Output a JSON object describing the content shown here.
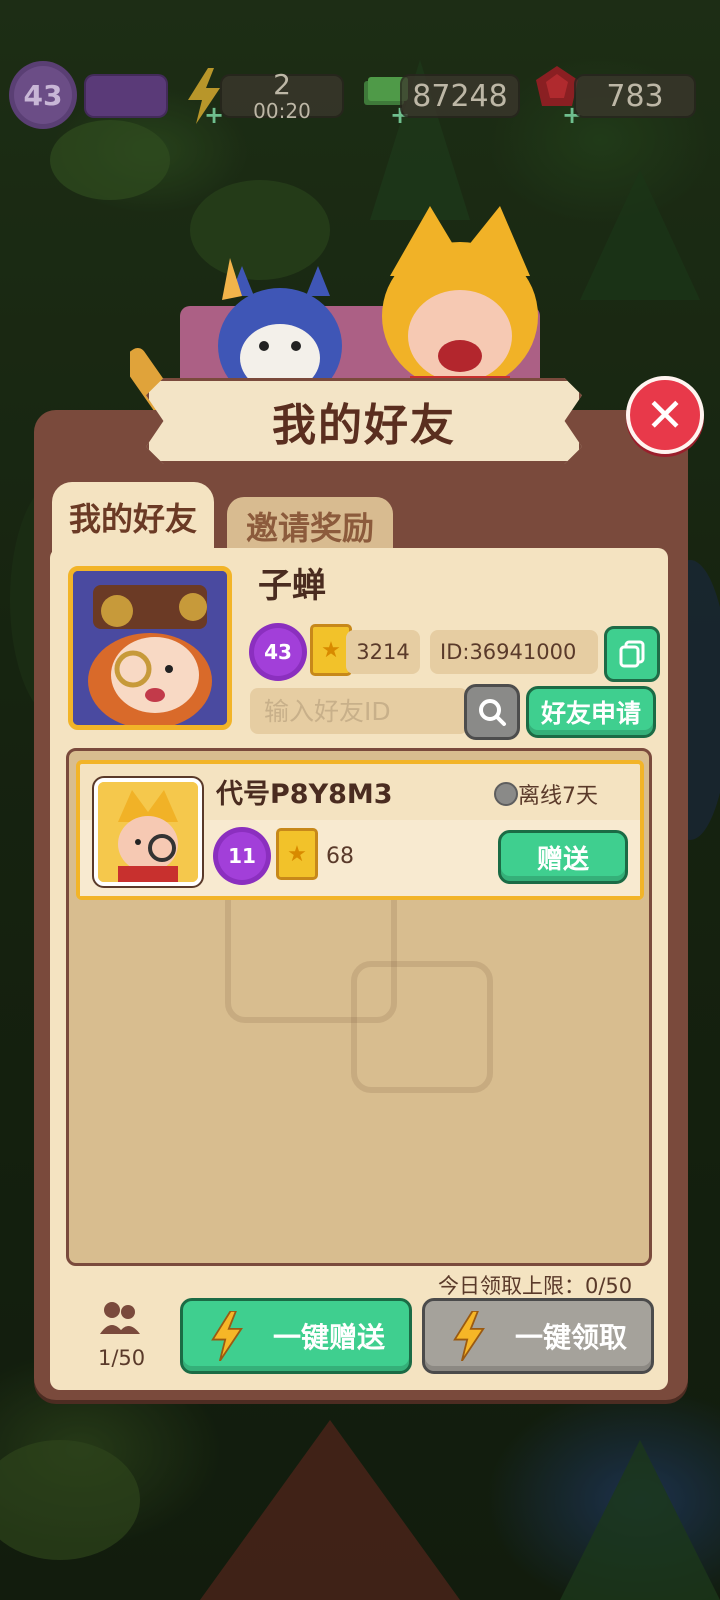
{
  "hud": {
    "level": "43",
    "energy_value": "2",
    "energy_timer": "00:20",
    "cash_value": "87248",
    "gem_value": "783"
  },
  "dialog": {
    "title": "我的好友",
    "tabs": [
      {
        "label": "我的好友",
        "active": true
      },
      {
        "label": "邀请奖励",
        "active": false
      }
    ]
  },
  "me": {
    "nickname": "子蝉",
    "level": "43",
    "score": "3214",
    "id_label": "ID:36941000",
    "search_placeholder": "输入好友ID",
    "apply_label": "好友申请"
  },
  "friends": [
    {
      "name": "代号P8Y8M3",
      "status": "离线7天",
      "level": "11",
      "score": "68",
      "gift_label": "赠送"
    }
  ],
  "footer": {
    "daily_limit": "今日领取上限：0/50",
    "friend_count": "1/50",
    "send_all_label": "一键赠送",
    "claim_all_label": "一键领取"
  },
  "colors": {
    "panel": "#7a4a3c",
    "panel_inner": "#f4e3c1",
    "green_button": "#3fcf8f",
    "grey_button": "#a5a29b",
    "close_button": "#e8394a",
    "level_badge": "#a23fd9",
    "highlight_border": "#f2b428"
  }
}
